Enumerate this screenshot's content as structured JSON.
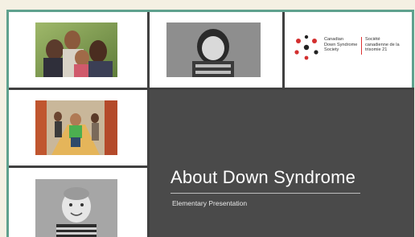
{
  "slide": {
    "title": "About Down Syndrome",
    "subtitle": "Elementary Presentation"
  },
  "logo": {
    "english_name_line1": "Canadian",
    "english_name_line2": "Down Syndrome",
    "english_name_line3": "Society",
    "french_name_line1": "Société",
    "french_name_line2": "canadienne de la",
    "french_name_line3": "trisomie 21"
  },
  "photos": [
    {
      "id": "family-photo",
      "icon": "family-image"
    },
    {
      "id": "woman-portrait",
      "icon": "portrait-image"
    },
    {
      "id": "playground-photo",
      "icon": "playground-image"
    },
    {
      "id": "toddler-portrait",
      "icon": "toddler-image"
    }
  ],
  "colors": {
    "frame_border": "#5fa18e",
    "dark_panel": "#4a4a4a",
    "logo_red": "#d32f2f",
    "logo_black": "#222222",
    "background": "#f4f0e3"
  }
}
